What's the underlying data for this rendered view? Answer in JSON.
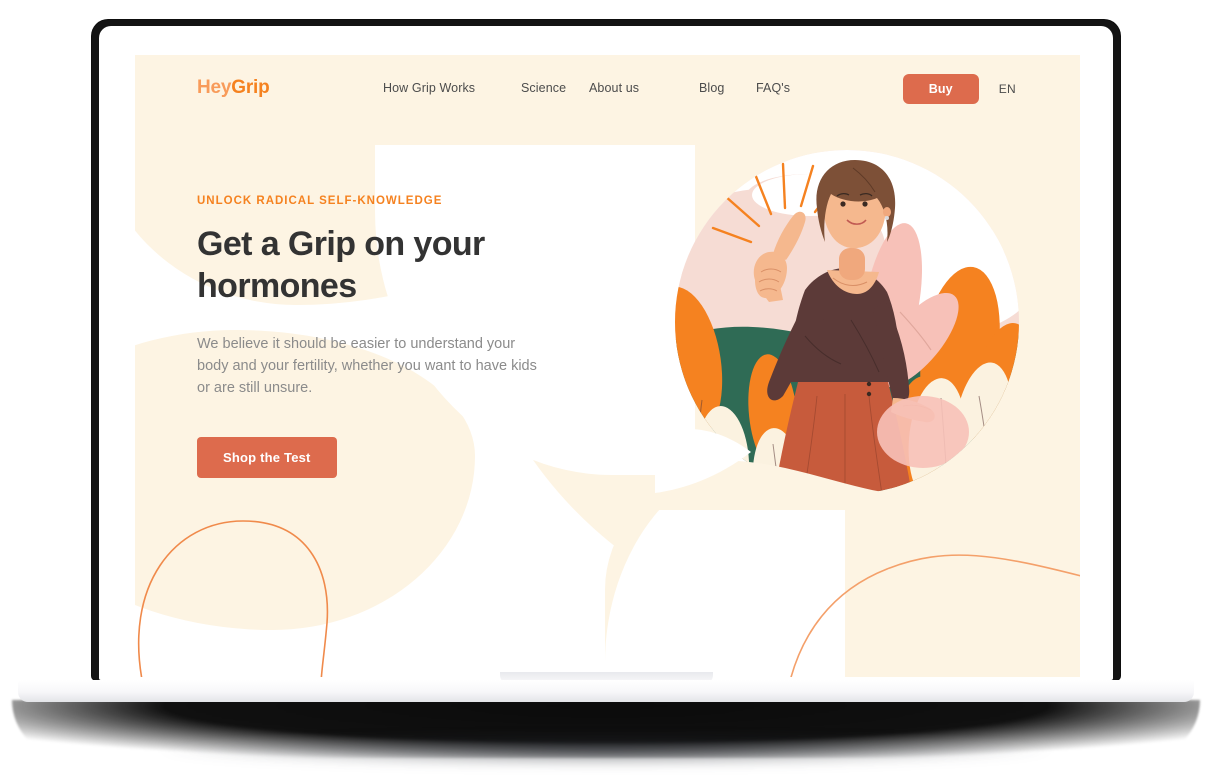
{
  "device": {
    "type": "laptop-mockup"
  },
  "site": {
    "logo": {
      "part1": "Hey",
      "part2": "Grip"
    },
    "nav": {
      "links": [
        {
          "label": "How Grip Works"
        },
        {
          "label": "Science"
        },
        {
          "label": "About us"
        },
        {
          "label": "Blog"
        },
        {
          "label": "FAQ's"
        }
      ],
      "buy_label": "Buy",
      "language": "EN"
    },
    "hero": {
      "eyebrow": "UNLOCK RADICAL SELF-KNOWLEDGE",
      "headline": "Get a Grip on your hormones",
      "subcopy": "We believe it should be easier to understand your body and your fertility, whether you want to have kids or are still unsure.",
      "cta_label": "Shop the Test",
      "illustration_alt": "woman pointing upward surrounded by plants"
    }
  },
  "colors": {
    "brand_orange": "#f58220",
    "logo_light": "#f89b5a",
    "cta_terracotta": "#dd6b4d",
    "cream": "#fdf4e3",
    "heading_dark": "#333333",
    "body_gray": "#8b8b8b",
    "nav_gray": "#4c4c4c",
    "illustration_pink": "#f6d9d2",
    "illustration_green": "#2f6b55",
    "illustration_skin": "#f5b88e",
    "illustration_top": "#5c3a38",
    "illustration_skirt": "#c75b3c",
    "bezel_black": "#141414",
    "page_white": "#ffffff"
  }
}
